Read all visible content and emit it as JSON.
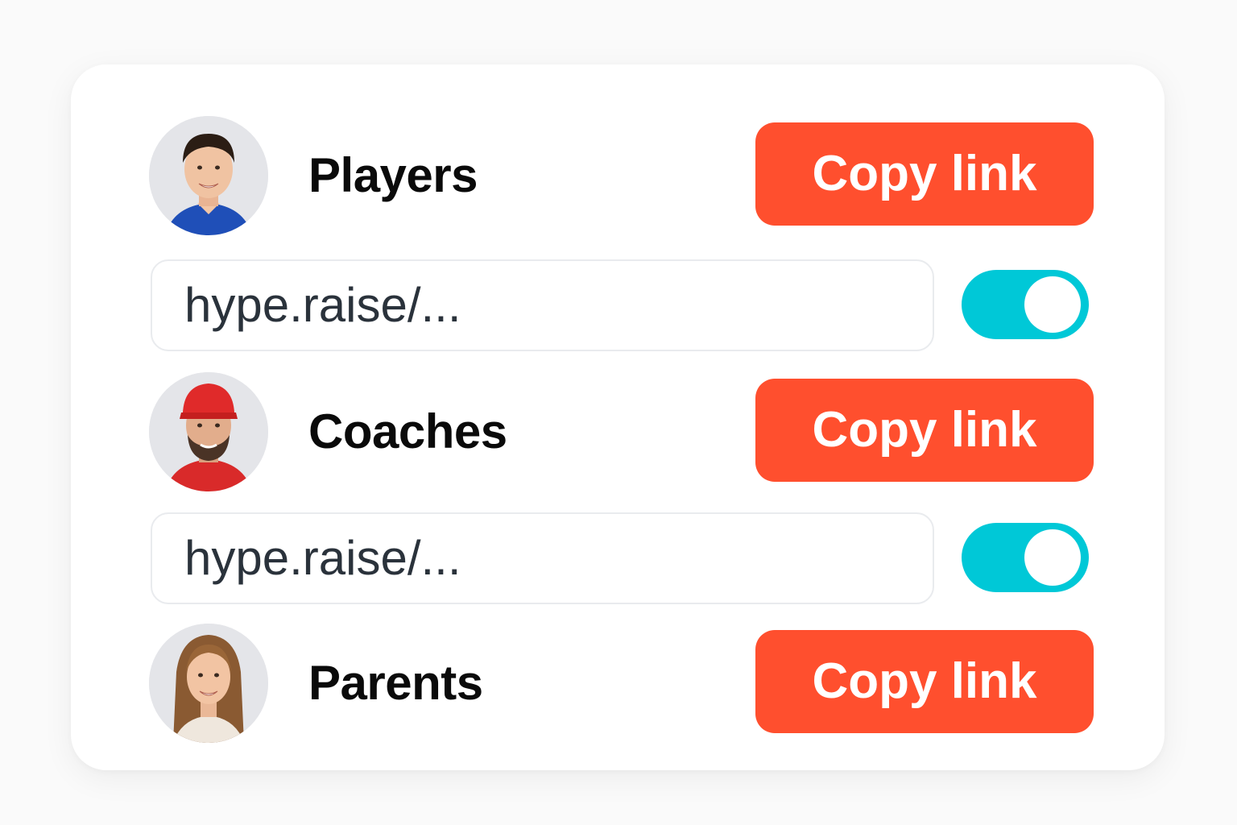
{
  "groups": [
    {
      "name": "Players",
      "button_label": "Copy link",
      "avatar_icon": "player-avatar-icon"
    },
    {
      "name": "Coaches",
      "button_label": "Copy link",
      "avatar_icon": "coach-avatar-icon"
    },
    {
      "name": "Parents",
      "button_label": "Copy link",
      "avatar_icon": "parent-avatar-icon"
    }
  ],
  "links": [
    {
      "url": "hype.raise/...",
      "enabled": true
    },
    {
      "url": "hype.raise/...",
      "enabled": true
    }
  ],
  "colors": {
    "copy_button": "#ff4f2e",
    "toggle_on": "#00c8d7",
    "card_background": "#ffffff"
  }
}
